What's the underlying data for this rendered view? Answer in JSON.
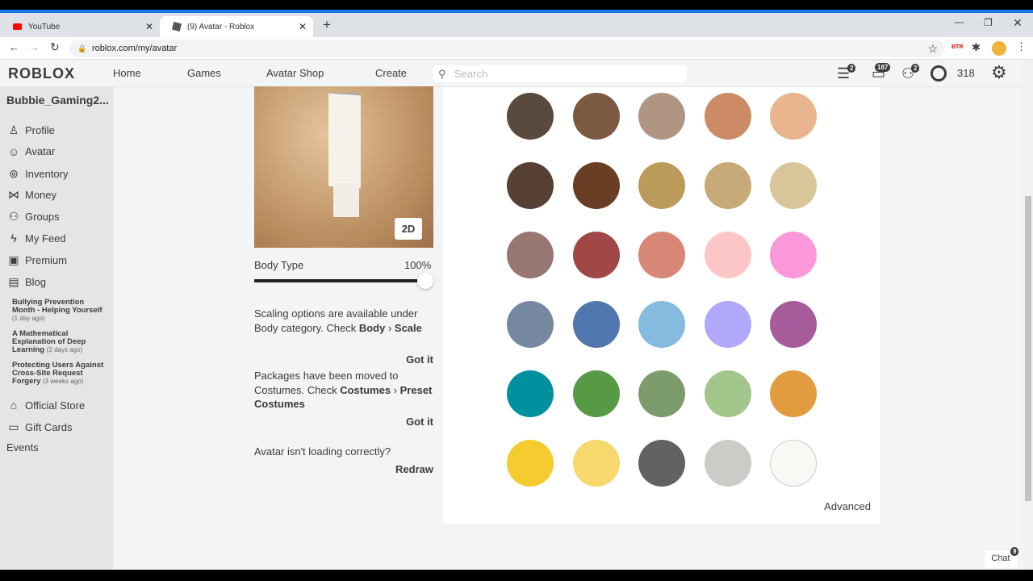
{
  "browser": {
    "tabs": [
      {
        "label": "YouTube"
      },
      {
        "label": "(9) Avatar - Roblox"
      }
    ],
    "url": "roblox.com/my/avatar",
    "ext_label": "BTR"
  },
  "nav": {
    "logo": "ROBLOX",
    "links": [
      "Home",
      "Games",
      "Avatar Shop",
      "Create"
    ],
    "search_placeholder": "Search",
    "notif_badges": [
      "2",
      "187",
      "2"
    ],
    "robux": "318"
  },
  "sidebar": {
    "username": "Bubbie_Gaming2...",
    "items": [
      {
        "label": "Profile",
        "icon": "person-icon"
      },
      {
        "label": "Avatar",
        "icon": "avatar-icon"
      },
      {
        "label": "Inventory",
        "icon": "lock-icon"
      },
      {
        "label": "Money",
        "icon": "money-icon"
      },
      {
        "label": "Groups",
        "icon": "groups-icon"
      },
      {
        "label": "My Feed",
        "icon": "feed-icon"
      },
      {
        "label": "Premium",
        "icon": "premium-icon"
      },
      {
        "label": "Blog",
        "icon": "blog-icon"
      }
    ],
    "blog_posts": [
      {
        "title": "Bullying Prevention Month - Helping Yourself",
        "age": "(1 day ago)"
      },
      {
        "title": "A Mathematical Explanation of Deep Learning",
        "age": "(2 days ago)"
      },
      {
        "title": "Protecting Users Against Cross-Site Request Forgery",
        "age": "(3 weeks ago)"
      }
    ],
    "bottom": [
      {
        "label": "Official Store",
        "icon": "store-icon"
      },
      {
        "label": "Gift Cards",
        "icon": "gift-card-icon"
      }
    ],
    "events": "Events"
  },
  "avatar": {
    "toggle_2d": "2D",
    "body_type_label": "Body Type",
    "body_type_value": "100%",
    "body_type_fraction": 1.0,
    "scaling_msg": "Scaling options are available under Body category. Check",
    "scaling_path1": "Body",
    "scaling_path2": "Scale",
    "got_it": "Got it",
    "packages_msg": "Packages have been moved to Costumes. Check",
    "packages_path1": "Costumes",
    "packages_path2": "Preset Costumes",
    "loading_msg": "Avatar isn't loading correctly?",
    "redraw": "Redraw"
  },
  "skin_tones": [
    [
      "#5a4a3e",
      "#7c5a42",
      "#b09582",
      "#cc8b64",
      "#e8b58e"
    ],
    [
      "#563f33",
      "#6a3e24",
      "#bc9a5a",
      "#c8a978",
      "#d8c69a"
    ],
    [
      "#987672",
      "#a04848",
      "#d88676",
      "#fdc6c6",
      "#fb98da"
    ],
    [
      "#7688a0",
      "#5078ae",
      "#84bbde",
      "#b2a8fb",
      "#a65c9a"
    ],
    [
      "#00909e",
      "#569a46",
      "#7c9c6c",
      "#a2c68c",
      "#e29b3e"
    ],
    [
      "#f4cc30",
      "#f7d86c",
      "#636262",
      "#cbcbc8",
      "#f8f8f5"
    ]
  ],
  "advanced": "Advanced",
  "chat": {
    "label": "Chat",
    "badge": "9"
  }
}
